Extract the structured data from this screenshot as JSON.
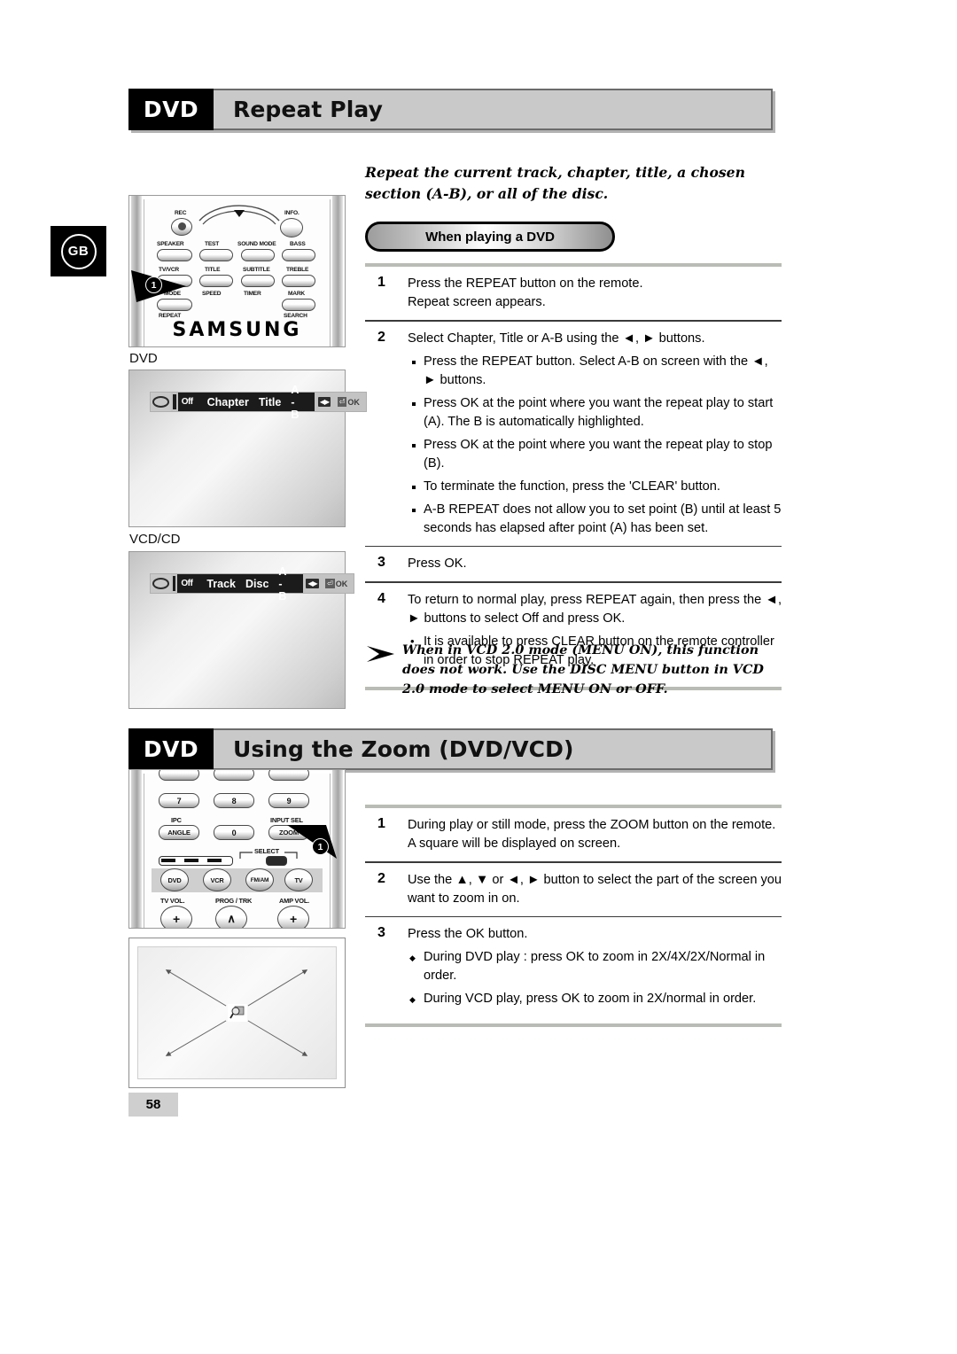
{
  "page": {
    "number": "58",
    "locale_badge": "GB"
  },
  "sections": [
    {
      "tag": "DVD",
      "title": "Repeat Play",
      "intro": "Repeat the current track, chapter, title, a chosen section (A-B), or all of the disc.",
      "pill": "When playing a DVD",
      "steps": [
        {
          "num": "1",
          "lines": [
            "Press the REPEAT button on the remote.",
            "Repeat screen appears."
          ],
          "sub": []
        },
        {
          "num": "2",
          "lines": [
            "Select Chapter, Title or A-B using the ◄, ► buttons."
          ],
          "sub": [
            "Press the REPEAT button. Select A-B on screen with the ◄, ► buttons.",
            "Press OK at the point where you want the repeat play to start (A). The B is automatically highlighted.",
            "Press OK at the point where you want the repeat play to stop (B).",
            "To terminate the function, press the 'CLEAR' button.",
            "A-B REPEAT does not allow you to set point (B) until at least 5 seconds has elapsed after point (A) has been set."
          ]
        },
        {
          "num": "3",
          "lines": [
            "Press OK."
          ],
          "sub": []
        },
        {
          "num": "4",
          "lines": [
            "To return to normal play, press REPEAT again, then press the ◄, ► buttons to select Off and press OK."
          ],
          "sub_mdot": [
            "It is available to press CLEAR button on the remote controller in order to stop REPEAT play."
          ]
        }
      ],
      "note": "When in VCD 2.0 mode (MENU ON), this function does not work. Use the DISC MENU button in VCD 2.0 mode to select MENU ON or OFF."
    },
    {
      "tag": "DVD",
      "title": "Using the Zoom (DVD/VCD)",
      "steps": [
        {
          "num": "1",
          "lines": [
            "During play or still mode, press the ZOOM button on the remote. A square will be displayed on screen."
          ],
          "sub": []
        },
        {
          "num": "2",
          "lines": [
            "Use the ▲, ▼ or ◄, ► button to select the part of the screen you want to zoom in on."
          ],
          "sub": []
        },
        {
          "num": "3",
          "lines": [
            "Press the OK button."
          ],
          "sub_diamond": [
            "During DVD play : press OK to zoom in 2X/4X/2X/Normal in order.",
            "During VCD play, press OK to zoom in 2X/normal in order."
          ]
        }
      ]
    }
  ],
  "remote_repeat": {
    "brand": "SAMSUNG",
    "callout": "1",
    "buttons": [
      {
        "label": "REC",
        "pos": "above"
      },
      {
        "label": "INFO.",
        "pos": "above"
      },
      {
        "label": "SPEAKER",
        "pos": "above"
      },
      {
        "label": "TEST",
        "pos": "above"
      },
      {
        "label": "SOUND MODE",
        "pos": "above"
      },
      {
        "label": "BASS",
        "pos": "above"
      },
      {
        "label": "TV/VCR",
        "pos": "above"
      },
      {
        "label": "TITLE",
        "pos": "above"
      },
      {
        "label": "SUBTITLE",
        "pos": "above"
      },
      {
        "label": "TREBLE",
        "pos": "above"
      },
      {
        "label": "MODE",
        "pos": "above"
      },
      {
        "label": "SPEED",
        "pos": "below"
      },
      {
        "label": "TIMER",
        "pos": "below"
      },
      {
        "label": "MARK",
        "pos": "above"
      },
      {
        "label": "REPEAT",
        "pos": "below"
      },
      {
        "label": "SEARCH",
        "pos": "below"
      }
    ]
  },
  "remote_zoom": {
    "callout": "1",
    "keys_row_top": [
      "7",
      "8",
      "9"
    ],
    "keys_row_bottom": [
      "ANGLE",
      "0",
      "ZOOM"
    ],
    "labels_above": [
      "IPC",
      "INPUT SEL"
    ],
    "select_label": "SELECT",
    "mode_buttons": [
      "DVD",
      "VCR",
      "FM/AM",
      "TV"
    ],
    "bottom_labels": [
      "TV VOL.",
      "PROG / TRK",
      "AMP VOL."
    ],
    "bottom_keys": [
      "+",
      "∧",
      "+"
    ]
  },
  "osd_dvd": {
    "caption": "DVD",
    "off": "Off",
    "items": [
      "Chapter",
      "Title",
      "A - B"
    ],
    "ok": "OK"
  },
  "osd_vcd": {
    "caption": "VCD/CD",
    "off": "Off",
    "items": [
      "Track",
      "Disc",
      "A - B"
    ],
    "ok": "OK"
  }
}
